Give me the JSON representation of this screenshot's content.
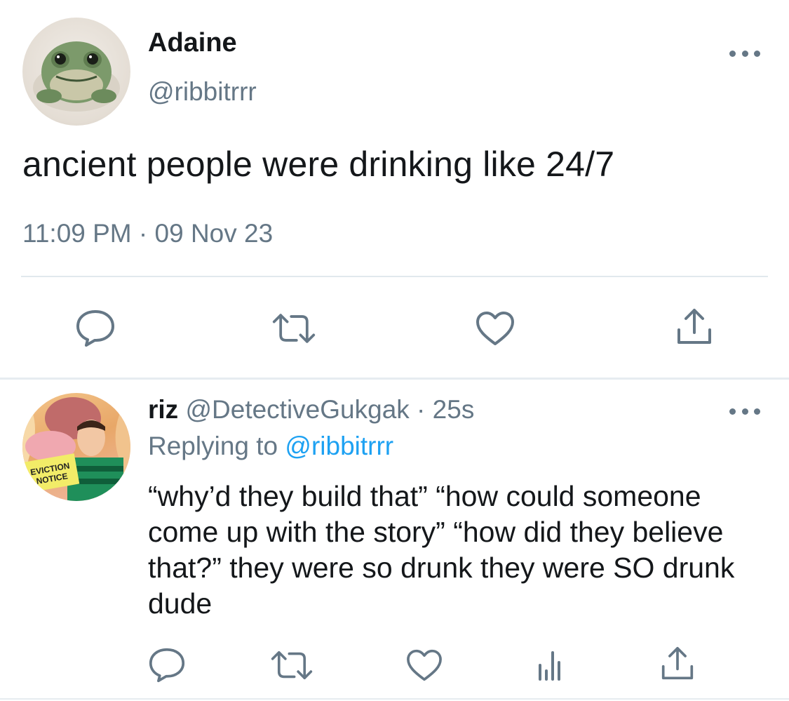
{
  "main_tweet": {
    "author_name": "Adaine",
    "author_handle": "@ribbitrrr",
    "text": "ancient people were drinking like 24/7",
    "timestamp": "11:09 PM · 09 Nov 23",
    "avatar": "frog-avatar",
    "actions": [
      "reply-icon",
      "retweet-icon",
      "like-icon",
      "share-icon"
    ]
  },
  "reply_tweet": {
    "author_name": "riz",
    "author_handle": "@DetectiveGukgak",
    "separator": " · ",
    "age": "25s",
    "replying_prefix": "Replying to ",
    "replying_to": "@ribbitrrr",
    "text": "“why’d they build that” “how could someone come up with the story” “how did they believe that?” they were so drunk they were SO drunk dude",
    "avatar": "eviction-notice-avatar",
    "avatar_sign_line1": "EVICTION",
    "avatar_sign_line2": "NOTICE",
    "actions": [
      "reply-icon",
      "retweet-icon",
      "like-icon",
      "stats-icon",
      "share-icon"
    ]
  },
  "colors": {
    "text": "#14171a",
    "secondary": "#657786",
    "link": "#1da1f2",
    "divider": "#e1e8ed"
  }
}
